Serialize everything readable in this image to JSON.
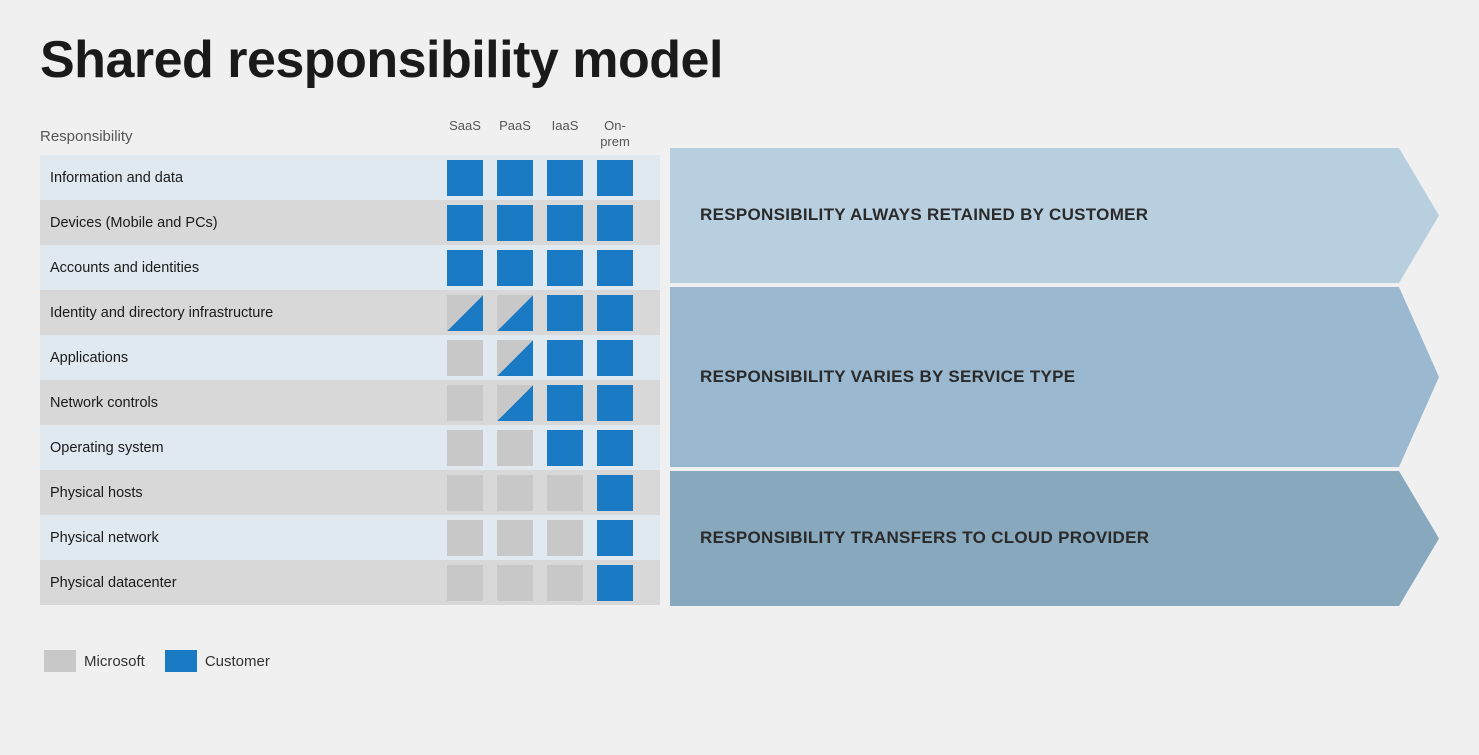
{
  "title": "Shared responsibility model",
  "table": {
    "header": {
      "responsibility_label": "Responsibility",
      "columns": [
        "SaaS",
        "PaaS",
        "IaaS",
        "On-prem"
      ]
    },
    "rows": [
      {
        "label": "Information and data",
        "cells": [
          "blue",
          "blue",
          "blue",
          "blue"
        ]
      },
      {
        "label": "Devices (Mobile and PCs)",
        "cells": [
          "blue",
          "blue",
          "blue",
          "blue"
        ]
      },
      {
        "label": "Accounts and identities",
        "cells": [
          "blue",
          "blue",
          "blue",
          "blue"
        ]
      },
      {
        "label": "Identity and directory infrastructure",
        "cells": [
          "half",
          "half",
          "blue",
          "blue"
        ]
      },
      {
        "label": "Applications",
        "cells": [
          "gray",
          "half",
          "blue",
          "blue"
        ]
      },
      {
        "label": "Network controls",
        "cells": [
          "gray",
          "half",
          "blue",
          "blue"
        ]
      },
      {
        "label": "Operating system",
        "cells": [
          "gray",
          "gray",
          "blue",
          "blue"
        ]
      },
      {
        "label": "Physical hosts",
        "cells": [
          "gray",
          "gray",
          "gray",
          "blue"
        ]
      },
      {
        "label": "Physical network",
        "cells": [
          "gray",
          "gray",
          "gray",
          "blue"
        ]
      },
      {
        "label": "Physical datacenter",
        "cells": [
          "gray",
          "gray",
          "gray",
          "blue"
        ]
      }
    ]
  },
  "arrows": [
    {
      "label": "RESPONSIBILITY ALWAYS RETAINED BY CUSTOMER",
      "rows": 3
    },
    {
      "label": "RESPONSIBILITY VARIES BY SERVICE TYPE",
      "rows": 4
    },
    {
      "label": "RESPONSIBILITY TRANSFERS TO CLOUD PROVIDER",
      "rows": 3
    }
  ],
  "legend": {
    "items": [
      {
        "type": "gray",
        "label": "Microsoft"
      },
      {
        "type": "blue",
        "label": "Customer"
      }
    ]
  }
}
